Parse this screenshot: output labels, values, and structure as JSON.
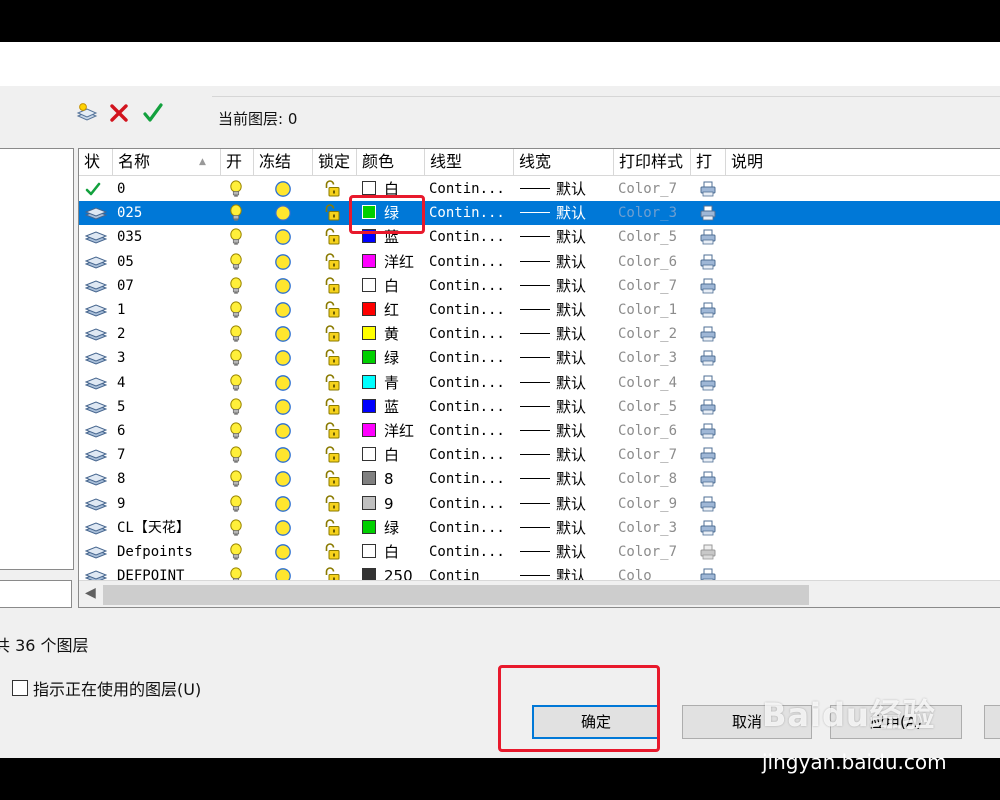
{
  "toolbar": {
    "icons": [
      "new-layer-icon",
      "delete-layer-icon",
      "set-current-icon"
    ],
    "current_layer_label": "当前图层: 0"
  },
  "columns": [
    "状",
    "名称",
    "开",
    "冻结",
    "锁定",
    "颜色",
    "线型",
    "线宽",
    "打印样式",
    "打",
    "说明"
  ],
  "layers": [
    {
      "status": "current",
      "name": "0",
      "color_name": "白",
      "color_hex": "#ffffff",
      "linetype": "Contin...",
      "lineweight": "默认",
      "plot_style": "Color_7"
    },
    {
      "status": "layer",
      "name": "025",
      "color_name": "绿",
      "color_hex": "#00d000",
      "linetype": "Contin...",
      "lineweight": "默认",
      "plot_style": "Color_3",
      "selected": true
    },
    {
      "status": "layer",
      "name": "035",
      "color_name": "蓝",
      "color_hex": "#0000ff",
      "linetype": "Contin...",
      "lineweight": "默认",
      "plot_style": "Color_5"
    },
    {
      "status": "layer",
      "name": "05",
      "color_name": "洋红",
      "color_hex": "#ff00ff",
      "linetype": "Contin...",
      "lineweight": "默认",
      "plot_style": "Color_6"
    },
    {
      "status": "layer",
      "name": "07",
      "color_name": "白",
      "color_hex": "#ffffff",
      "linetype": "Contin...",
      "lineweight": "默认",
      "plot_style": "Color_7"
    },
    {
      "status": "layer",
      "name": "1",
      "color_name": "红",
      "color_hex": "#ff0000",
      "linetype": "Contin...",
      "lineweight": "默认",
      "plot_style": "Color_1"
    },
    {
      "status": "layer",
      "name": "2",
      "color_name": "黄",
      "color_hex": "#ffff00",
      "linetype": "Contin...",
      "lineweight": "默认",
      "plot_style": "Color_2"
    },
    {
      "status": "layer",
      "name": "3",
      "color_name": "绿",
      "color_hex": "#00d000",
      "linetype": "Contin...",
      "lineweight": "默认",
      "plot_style": "Color_3"
    },
    {
      "status": "layer",
      "name": "4",
      "color_name": "青",
      "color_hex": "#00ffff",
      "linetype": "Contin...",
      "lineweight": "默认",
      "plot_style": "Color_4"
    },
    {
      "status": "layer",
      "name": "5",
      "color_name": "蓝",
      "color_hex": "#0000ff",
      "linetype": "Contin...",
      "lineweight": "默认",
      "plot_style": "Color_5"
    },
    {
      "status": "layer",
      "name": "6",
      "color_name": "洋红",
      "color_hex": "#ff00ff",
      "linetype": "Contin...",
      "lineweight": "默认",
      "plot_style": "Color_6"
    },
    {
      "status": "layer",
      "name": "7",
      "color_name": "白",
      "color_hex": "#ffffff",
      "linetype": "Contin...",
      "lineweight": "默认",
      "plot_style": "Color_7"
    },
    {
      "status": "layer",
      "name": "8",
      "color_name": "8",
      "color_hex": "#808080",
      "linetype": "Contin...",
      "lineweight": "默认",
      "plot_style": "Color_8"
    },
    {
      "status": "layer",
      "name": "9",
      "color_name": "9",
      "color_hex": "#c0c0c0",
      "linetype": "Contin...",
      "lineweight": "默认",
      "plot_style": "Color_9"
    },
    {
      "status": "layer",
      "name": "CL【天花】",
      "color_name": "绿",
      "color_hex": "#00d000",
      "linetype": "Contin...",
      "lineweight": "默认",
      "plot_style": "Color_3"
    },
    {
      "status": "layer",
      "name": "Defpoints",
      "color_name": "白",
      "color_hex": "#ffffff",
      "linetype": "Contin...",
      "lineweight": "默认",
      "plot_style": "Color_7",
      "no_plot": true
    },
    {
      "status": "layer",
      "name": "DEFPOINT",
      "color_name": "250",
      "color_hex": "#333333",
      "linetype": "Contin",
      "lineweight": "默认",
      "plot_style": "Colo"
    }
  ],
  "footer": {
    "total_text": "共 36 个图层",
    "checkbox_label": "指示正在使用的图层(U)",
    "ok_label": "确定",
    "cancel_label": "取消",
    "apply_label": "应用(A)"
  },
  "watermark": {
    "logo_text": "Baidu经验",
    "url": "jingyan.baidu.com"
  }
}
